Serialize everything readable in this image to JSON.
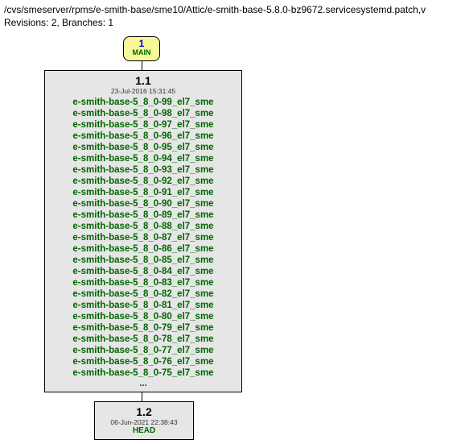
{
  "header": {
    "path": "/cvs/smeserver/rpms/e-smith-base/sme10/Attic/e-smith-base-5.8.0-bz9672.servicesystemd.patch,v",
    "revisions_line": "Revisions: 2, Branches: 1"
  },
  "main_node": {
    "number": "1",
    "label": "MAIN"
  },
  "rev11": {
    "version": "1.1",
    "date": "23-Jul-2016 15:31:45",
    "tags": [
      "e-smith-base-5_8_0-99_el7_sme",
      "e-smith-base-5_8_0-98_el7_sme",
      "e-smith-base-5_8_0-97_el7_sme",
      "e-smith-base-5_8_0-96_el7_sme",
      "e-smith-base-5_8_0-95_el7_sme",
      "e-smith-base-5_8_0-94_el7_sme",
      "e-smith-base-5_8_0-93_el7_sme",
      "e-smith-base-5_8_0-92_el7_sme",
      "e-smith-base-5_8_0-91_el7_sme",
      "e-smith-base-5_8_0-90_el7_sme",
      "e-smith-base-5_8_0-89_el7_sme",
      "e-smith-base-5_8_0-88_el7_sme",
      "e-smith-base-5_8_0-87_el7_sme",
      "e-smith-base-5_8_0-86_el7_sme",
      "e-smith-base-5_8_0-85_el7_sme",
      "e-smith-base-5_8_0-84_el7_sme",
      "e-smith-base-5_8_0-83_el7_sme",
      "e-smith-base-5_8_0-82_el7_sme",
      "e-smith-base-5_8_0-81_el7_sme",
      "e-smith-base-5_8_0-80_el7_sme",
      "e-smith-base-5_8_0-79_el7_sme",
      "e-smith-base-5_8_0-78_el7_sme",
      "e-smith-base-5_8_0-77_el7_sme",
      "e-smith-base-5_8_0-76_el7_sme",
      "e-smith-base-5_8_0-75_el7_sme"
    ],
    "ellipsis": "..."
  },
  "rev12": {
    "version": "1.2",
    "date": "06-Jun-2021 22:38:43",
    "tag": "HEAD"
  }
}
